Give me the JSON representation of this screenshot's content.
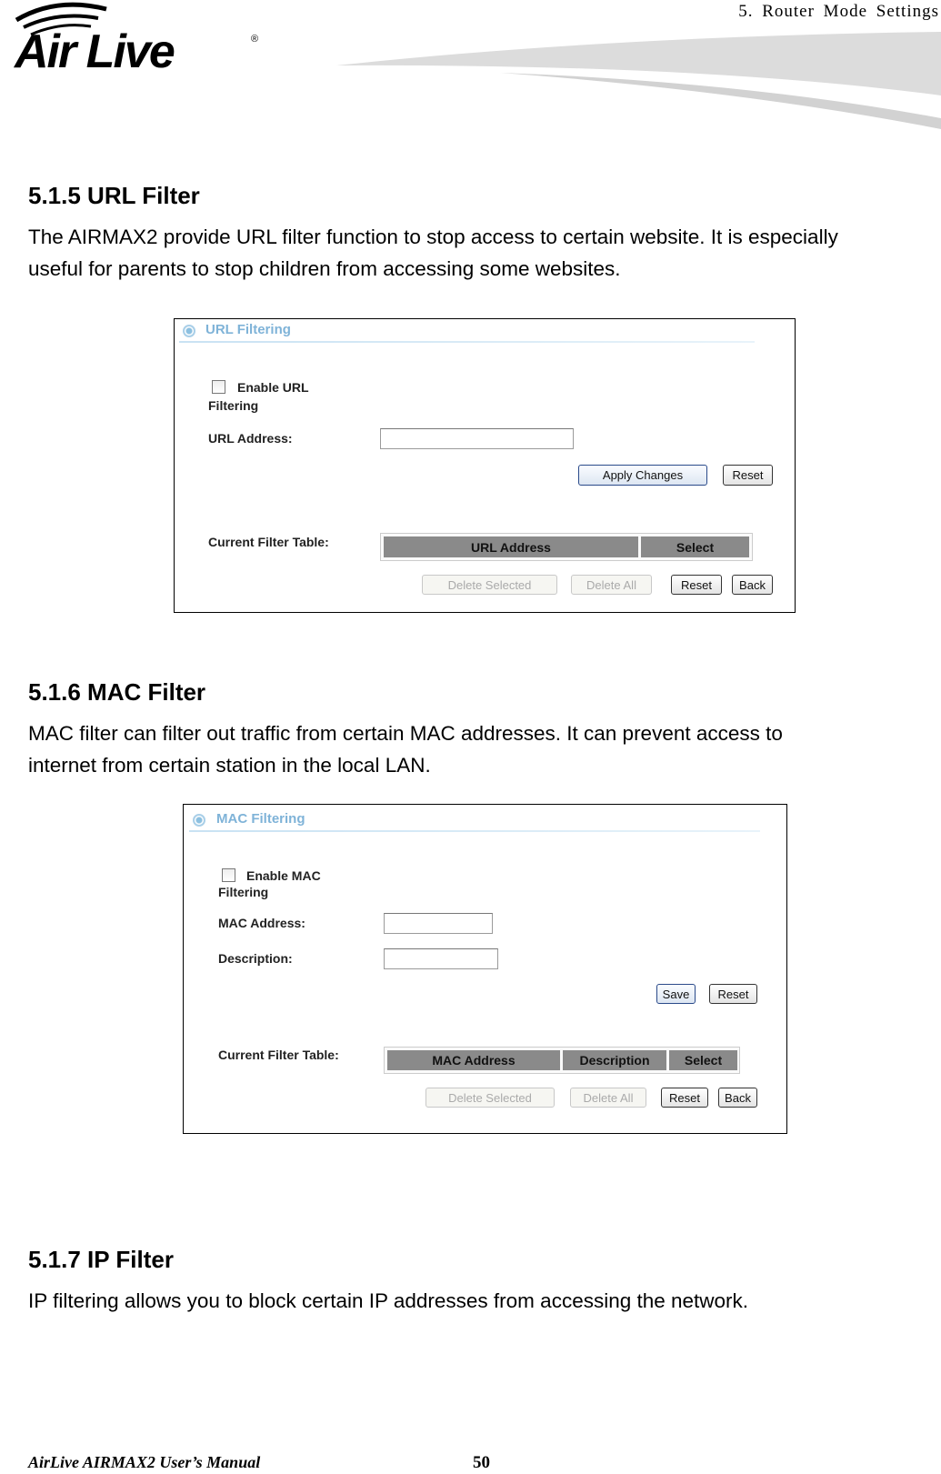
{
  "header": {
    "chapter": "5.   Router  Mode  Settings",
    "logo_text": "Air Live"
  },
  "sections": [
    {
      "title": "5.1.5 URL Filter",
      "lines": [
        "The AIRMAX2 provide URL filter function to stop access to certain website.    It is especially",
        "useful for parents to stop children from accessing some websites."
      ]
    },
    {
      "title": "5.1.6 MAC Filter",
      "lines": [
        "MAC filter can filter out traffic from certain MAC addresses.    It can prevent access to",
        "internet from certain station in the local LAN."
      ]
    },
    {
      "title": "5.1.7 IP Filter",
      "lines": [
        "IP filtering allows you to block certain IP addresses from accessing the network."
      ]
    }
  ],
  "url_panel": {
    "title": "URL Filtering",
    "enable_label_1": "Enable URL",
    "enable_label_2": "Filtering",
    "enabled": false,
    "url_label": "URL Address:",
    "url_value": "",
    "apply": "Apply Changes",
    "reset": "Reset",
    "table_label": "Current Filter Table:",
    "columns": [
      "URL Address",
      "Select"
    ],
    "delete_selected": "Delete Selected",
    "delete_all": "Delete All",
    "reset2": "Reset",
    "back": "Back"
  },
  "mac_panel": {
    "title": "MAC Filtering",
    "enable_label_1": "Enable MAC",
    "enable_label_2": "Filtering",
    "enabled": false,
    "mac_label": "MAC Address:",
    "mac_value": "",
    "desc_label": "Description:",
    "desc_value": "",
    "save": "Save",
    "reset": "Reset",
    "table_label": "Current Filter Table:",
    "columns": [
      "MAC Address",
      "Description",
      "Select"
    ],
    "delete_selected": "Delete Selected",
    "delete_all": "Delete All",
    "reset2": "Reset",
    "back": "Back"
  },
  "footer": {
    "manual": "AirLive AIRMAX2 User’s Manual",
    "page": "50"
  }
}
